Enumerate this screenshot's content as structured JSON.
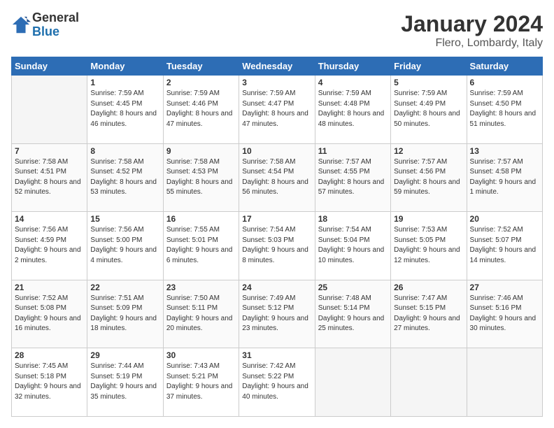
{
  "logo": {
    "general": "General",
    "blue": "Blue"
  },
  "title": "January 2024",
  "location": "Flero, Lombardy, Italy",
  "weekdays": [
    "Sunday",
    "Monday",
    "Tuesday",
    "Wednesday",
    "Thursday",
    "Friday",
    "Saturday"
  ],
  "weeks": [
    [
      {
        "day": "",
        "empty": true
      },
      {
        "day": "1",
        "sunrise": "7:59 AM",
        "sunset": "4:45 PM",
        "daylight": "8 hours and 46 minutes."
      },
      {
        "day": "2",
        "sunrise": "7:59 AM",
        "sunset": "4:46 PM",
        "daylight": "8 hours and 47 minutes."
      },
      {
        "day": "3",
        "sunrise": "7:59 AM",
        "sunset": "4:47 PM",
        "daylight": "8 hours and 47 minutes."
      },
      {
        "day": "4",
        "sunrise": "7:59 AM",
        "sunset": "4:48 PM",
        "daylight": "8 hours and 48 minutes."
      },
      {
        "day": "5",
        "sunrise": "7:59 AM",
        "sunset": "4:49 PM",
        "daylight": "8 hours and 50 minutes."
      },
      {
        "day": "6",
        "sunrise": "7:59 AM",
        "sunset": "4:50 PM",
        "daylight": "8 hours and 51 minutes."
      }
    ],
    [
      {
        "day": "7",
        "sunrise": "7:58 AM",
        "sunset": "4:51 PM",
        "daylight": "8 hours and 52 minutes."
      },
      {
        "day": "8",
        "sunrise": "7:58 AM",
        "sunset": "4:52 PM",
        "daylight": "8 hours and 53 minutes."
      },
      {
        "day": "9",
        "sunrise": "7:58 AM",
        "sunset": "4:53 PM",
        "daylight": "8 hours and 55 minutes."
      },
      {
        "day": "10",
        "sunrise": "7:58 AM",
        "sunset": "4:54 PM",
        "daylight": "8 hours and 56 minutes."
      },
      {
        "day": "11",
        "sunrise": "7:57 AM",
        "sunset": "4:55 PM",
        "daylight": "8 hours and 57 minutes."
      },
      {
        "day": "12",
        "sunrise": "7:57 AM",
        "sunset": "4:56 PM",
        "daylight": "8 hours and 59 minutes."
      },
      {
        "day": "13",
        "sunrise": "7:57 AM",
        "sunset": "4:58 PM",
        "daylight": "9 hours and 1 minute."
      }
    ],
    [
      {
        "day": "14",
        "sunrise": "7:56 AM",
        "sunset": "4:59 PM",
        "daylight": "9 hours and 2 minutes."
      },
      {
        "day": "15",
        "sunrise": "7:56 AM",
        "sunset": "5:00 PM",
        "daylight": "9 hours and 4 minutes."
      },
      {
        "day": "16",
        "sunrise": "7:55 AM",
        "sunset": "5:01 PM",
        "daylight": "9 hours and 6 minutes."
      },
      {
        "day": "17",
        "sunrise": "7:54 AM",
        "sunset": "5:03 PM",
        "daylight": "9 hours and 8 minutes."
      },
      {
        "day": "18",
        "sunrise": "7:54 AM",
        "sunset": "5:04 PM",
        "daylight": "9 hours and 10 minutes."
      },
      {
        "day": "19",
        "sunrise": "7:53 AM",
        "sunset": "5:05 PM",
        "daylight": "9 hours and 12 minutes."
      },
      {
        "day": "20",
        "sunrise": "7:52 AM",
        "sunset": "5:07 PM",
        "daylight": "9 hours and 14 minutes."
      }
    ],
    [
      {
        "day": "21",
        "sunrise": "7:52 AM",
        "sunset": "5:08 PM",
        "daylight": "9 hours and 16 minutes."
      },
      {
        "day": "22",
        "sunrise": "7:51 AM",
        "sunset": "5:09 PM",
        "daylight": "9 hours and 18 minutes."
      },
      {
        "day": "23",
        "sunrise": "7:50 AM",
        "sunset": "5:11 PM",
        "daylight": "9 hours and 20 minutes."
      },
      {
        "day": "24",
        "sunrise": "7:49 AM",
        "sunset": "5:12 PM",
        "daylight": "9 hours and 23 minutes."
      },
      {
        "day": "25",
        "sunrise": "7:48 AM",
        "sunset": "5:14 PM",
        "daylight": "9 hours and 25 minutes."
      },
      {
        "day": "26",
        "sunrise": "7:47 AM",
        "sunset": "5:15 PM",
        "daylight": "9 hours and 27 minutes."
      },
      {
        "day": "27",
        "sunrise": "7:46 AM",
        "sunset": "5:16 PM",
        "daylight": "9 hours and 30 minutes."
      }
    ],
    [
      {
        "day": "28",
        "sunrise": "7:45 AM",
        "sunset": "5:18 PM",
        "daylight": "9 hours and 32 minutes."
      },
      {
        "day": "29",
        "sunrise": "7:44 AM",
        "sunset": "5:19 PM",
        "daylight": "9 hours and 35 minutes."
      },
      {
        "day": "30",
        "sunrise": "7:43 AM",
        "sunset": "5:21 PM",
        "daylight": "9 hours and 37 minutes."
      },
      {
        "day": "31",
        "sunrise": "7:42 AM",
        "sunset": "5:22 PM",
        "daylight": "9 hours and 40 minutes."
      },
      {
        "day": "",
        "empty": true
      },
      {
        "day": "",
        "empty": true
      },
      {
        "day": "",
        "empty": true
      }
    ]
  ]
}
